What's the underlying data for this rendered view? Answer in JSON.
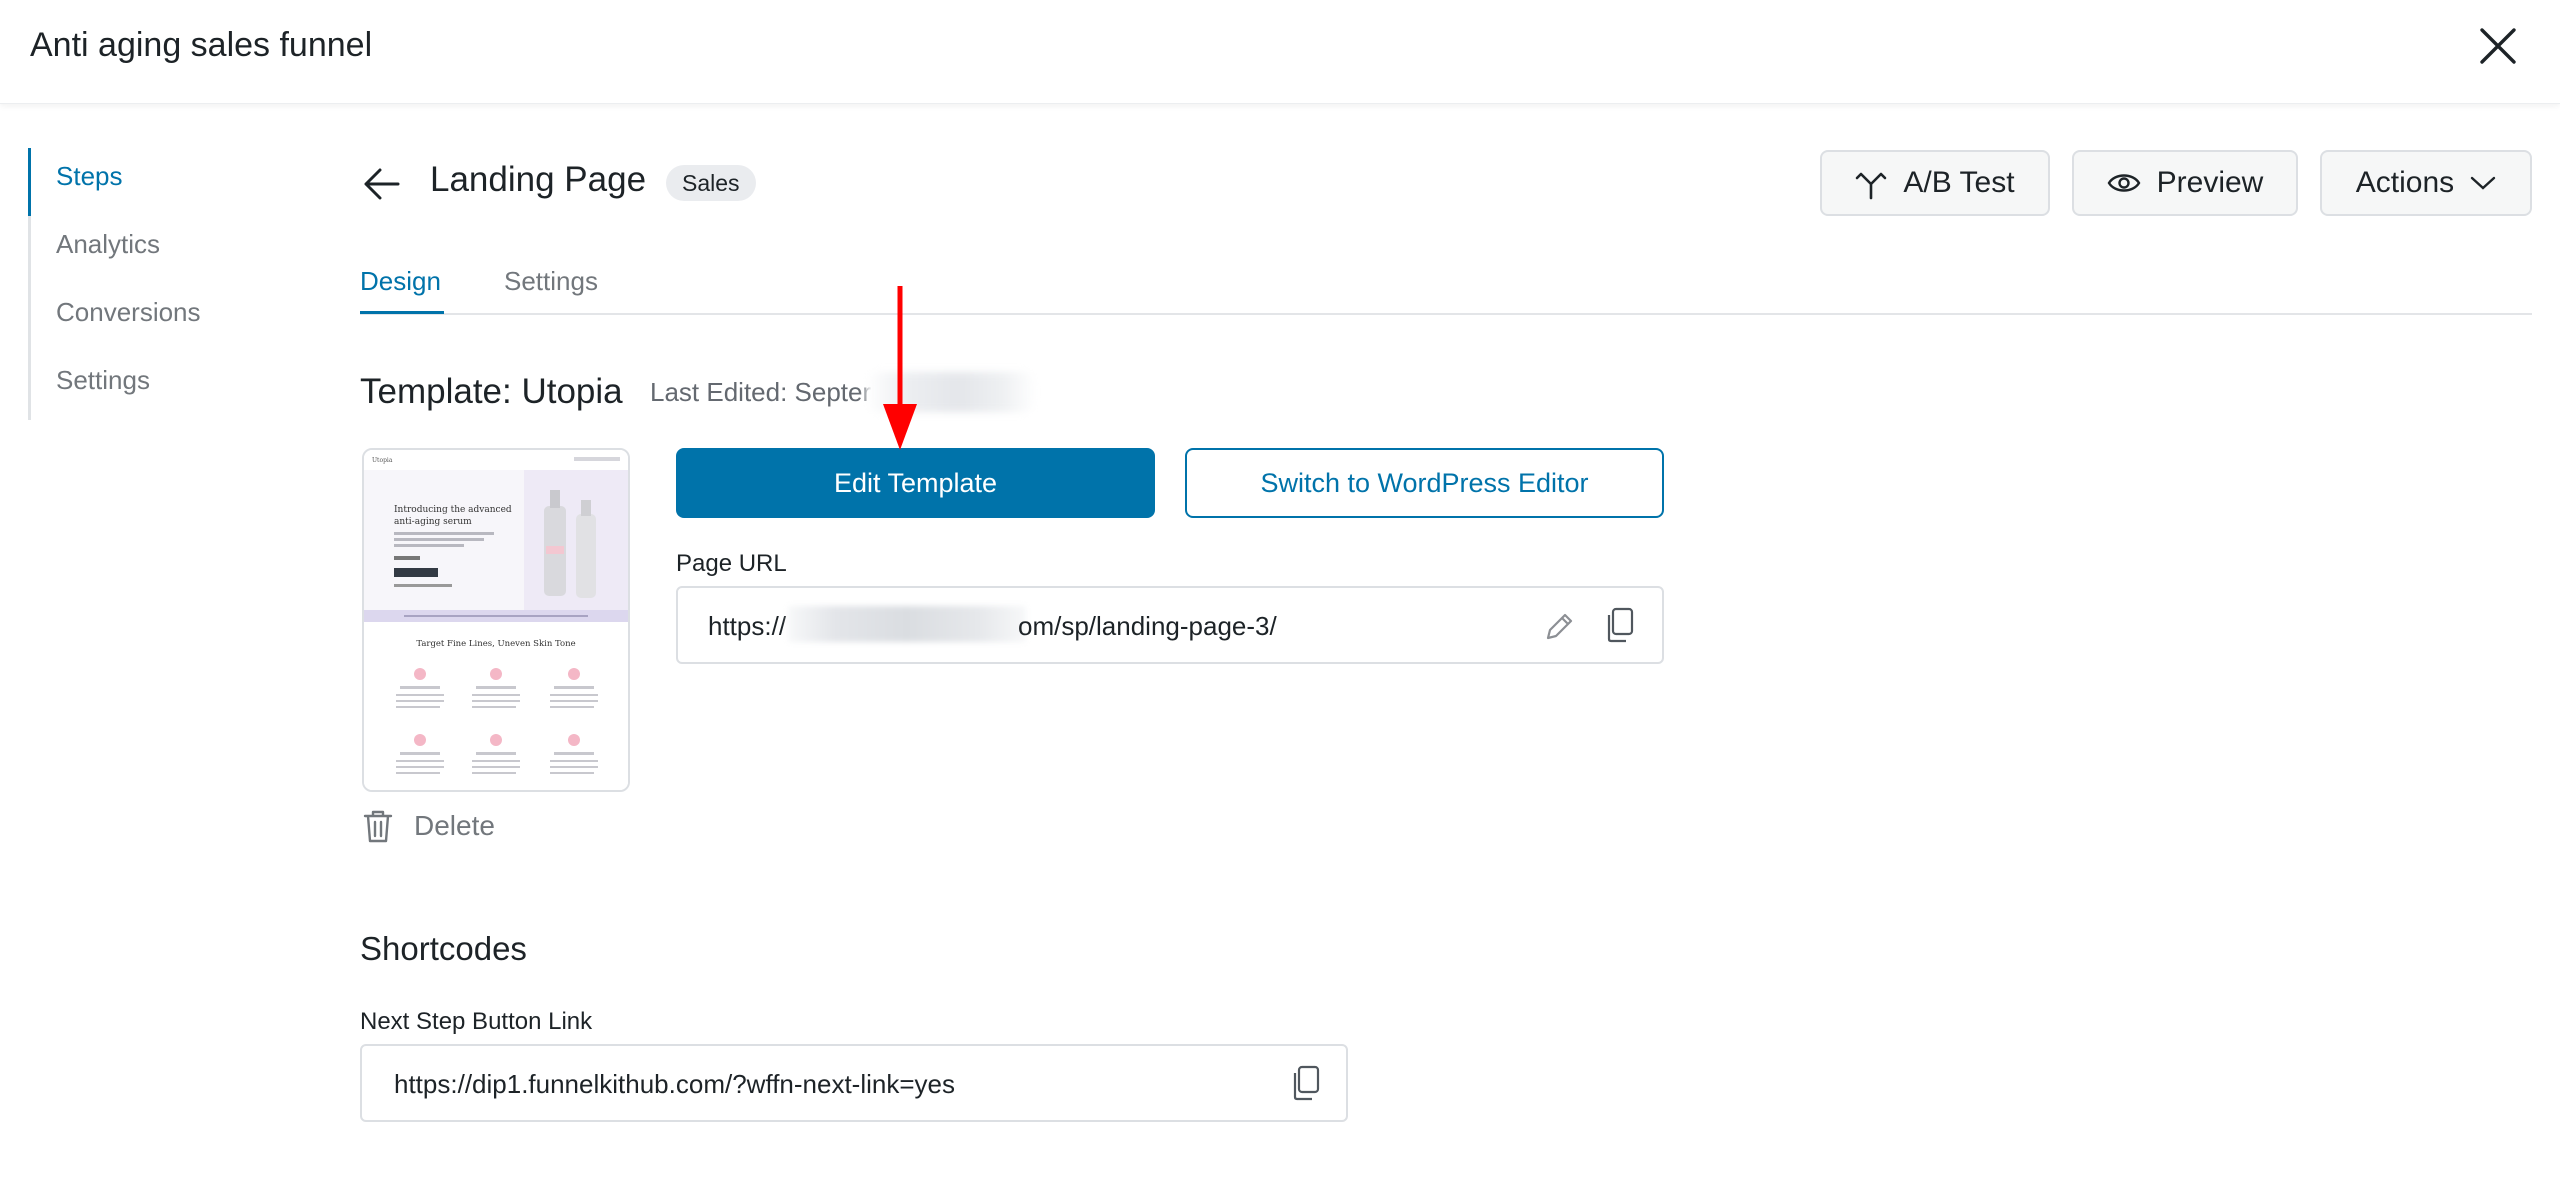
{
  "header": {
    "title": "Anti aging sales funnel"
  },
  "sidebar": {
    "items": [
      {
        "label": "Steps",
        "active": true
      },
      {
        "label": "Analytics",
        "active": false
      },
      {
        "label": "Conversions",
        "active": false
      },
      {
        "label": "Settings",
        "active": false
      }
    ]
  },
  "step": {
    "title": "Landing Page",
    "badge": "Sales",
    "buttons": {
      "ab_test": "A/B Test",
      "preview": "Preview",
      "actions": "Actions"
    }
  },
  "tabs": [
    {
      "label": "Design",
      "active": true
    },
    {
      "label": "Settings",
      "active": false
    }
  ],
  "template": {
    "name": "Template: Utopia",
    "last_edited": "Last Edited: Septer",
    "edit_label": "Edit Template",
    "switch_label": "Switch to WordPress Editor",
    "delete_label": "Delete",
    "thumbnail": {
      "logo": "Utopia",
      "headline": "Introducing the advanced anti-aging serum",
      "section_heading": "Target Fine Lines, Uneven Skin Tone"
    }
  },
  "page_url": {
    "label": "Page URL",
    "prefix": "https://",
    "suffix": "om/sp/landing-page-3/"
  },
  "shortcodes": {
    "title": "Shortcodes",
    "next_step_label": "Next Step Button Link",
    "next_step_url": "https://dip1.funnelkithub.com/?wffn-next-link=yes"
  },
  "colors": {
    "accent": "#0073aa",
    "annotation": "#ff0000"
  },
  "icons": {
    "close": "close-icon",
    "back": "arrow-left-icon",
    "ab_test": "split-icon",
    "preview": "eye-icon",
    "actions": "chevron-down-icon",
    "delete": "trash-icon",
    "edit": "pencil-icon",
    "copy": "copy-icon"
  }
}
